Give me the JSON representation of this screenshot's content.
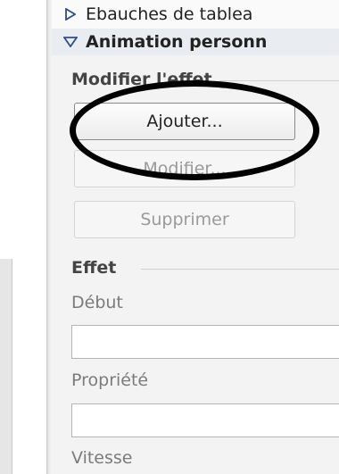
{
  "pane": {
    "sections": [
      {
        "label": "Ebauches de tablea",
        "expanded": false,
        "icon": "collapsed-triangle-icon"
      },
      {
        "label": "Animation personn",
        "expanded": true,
        "icon": "expanded-triangle-icon"
      }
    ],
    "modify_effect": {
      "group_label": "Modifier l'effet",
      "add_button": "Ajouter...",
      "modify_button": "Modifier...",
      "delete_button": "Supprimer"
    },
    "effect": {
      "group_label": "Effet",
      "start_label": "Début",
      "start_value": "",
      "property_label": "Propriété",
      "property_value": "",
      "speed_label": "Vitesse"
    }
  },
  "annotation": {
    "shape": "hand-drawn-circle",
    "color": "#000000",
    "target": "add_button"
  }
}
